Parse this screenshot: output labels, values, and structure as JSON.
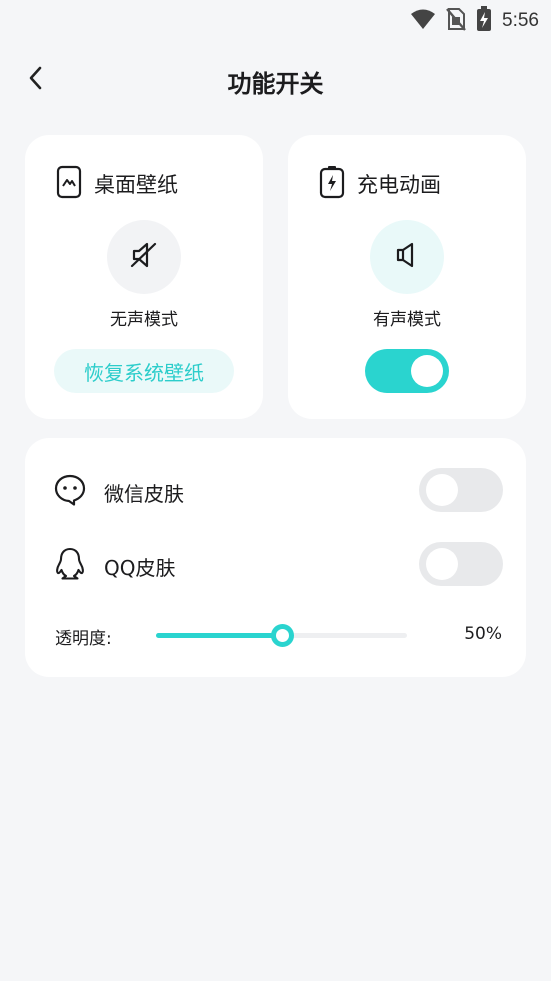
{
  "status_bar": {
    "time": "5:56",
    "icons": [
      "wifi-icon",
      "no-sim-icon",
      "battery-charging-icon"
    ]
  },
  "header": {
    "title": "功能开关",
    "back_icon": "chevron-left-icon"
  },
  "wallpaper_card": {
    "title": "桌面壁纸",
    "icon": "wallpaper-icon",
    "mode_icon": "speaker-muted-icon",
    "mode_label": "无声模式",
    "restore_label": "恢复系统壁纸"
  },
  "charge_card": {
    "title": "充电动画",
    "icon": "battery-bolt-icon",
    "mode_icon": "speaker-icon",
    "mode_label": "有声模式",
    "toggle_on": true
  },
  "skins": {
    "wechat": {
      "label": "微信皮肤",
      "icon": "wechat-icon",
      "toggle_on": false
    },
    "qq": {
      "label": "QQ皮肤",
      "icon": "qq-penguin-icon",
      "toggle_on": false
    },
    "opacity": {
      "label": "透明度:",
      "value_text": "50%",
      "value": 50
    }
  },
  "colors": {
    "accent": "#2ad4cf",
    "accent_light": "#eaf9f9",
    "toggle_off": "#e8e9eb",
    "background": "#f5f6f8",
    "card": "#ffffff"
  }
}
